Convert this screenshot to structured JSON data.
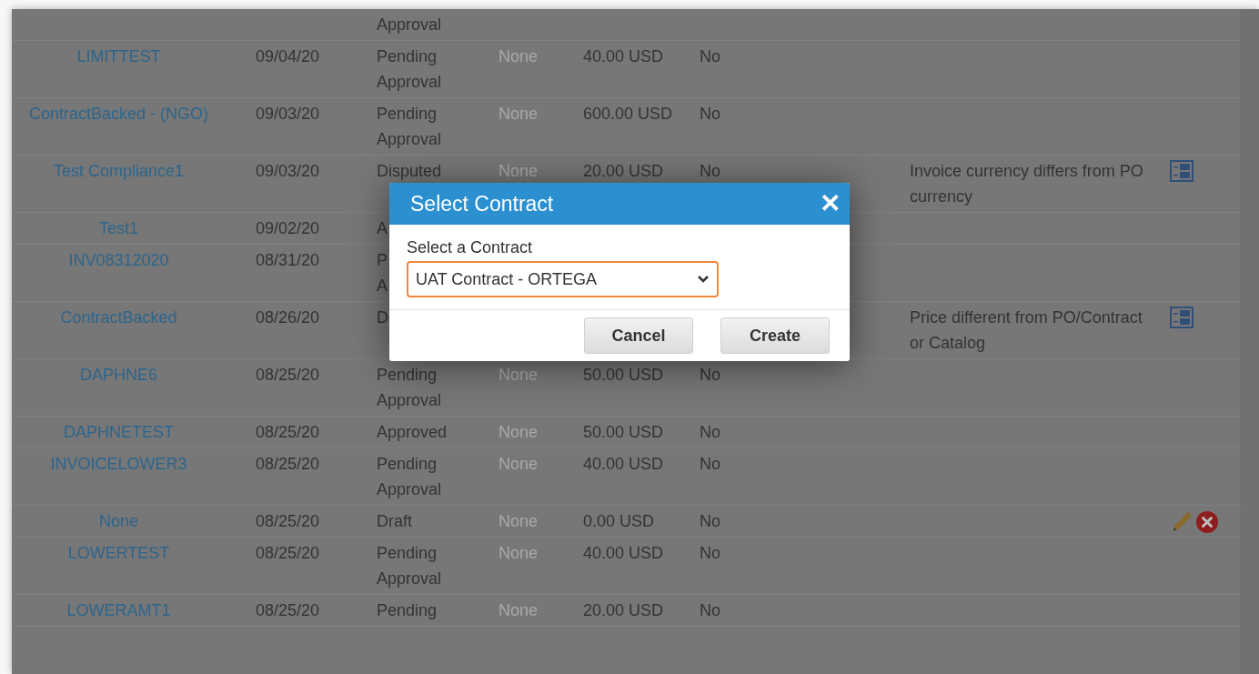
{
  "rows": [
    {
      "kind": "standard",
      "status": [
        "Approval"
      ]
    },
    {
      "kind": "standard",
      "name": "LIMITTEST",
      "date": "09/04/20",
      "status": [
        "Pending",
        "Approval"
      ],
      "column_4": "None",
      "amount": "40.00 USD",
      "column_6": "No"
    },
    {
      "kind": "standard",
      "name": "ContractBacked - (NGO)",
      "date": "09/03/20",
      "status": [
        "Pending",
        "Approval"
      ],
      "column_4": "None",
      "amount": "600.00 USD",
      "column_6": "No"
    },
    {
      "kind": "exception",
      "name": "Test Compliance1",
      "date": "09/03/20",
      "status": [
        "Disputed"
      ],
      "column_4": "None",
      "amount": "20.00 USD",
      "column_6": "No",
      "note": [
        "Invoice currency differs from PO",
        "currency"
      ]
    },
    {
      "kind": "standard",
      "name": "Test1",
      "date": "09/02/20",
      "status": [
        "A"
      ]
    },
    {
      "kind": "standard",
      "name": "INV08312020",
      "date": "08/31/20",
      "status": [
        "P",
        "A"
      ]
    },
    {
      "kind": "exception",
      "name": "ContractBacked",
      "date": "08/26/20",
      "status": [
        "D"
      ],
      "note": [
        "Price different from PO/Contract",
        "or Catalog"
      ]
    },
    {
      "kind": "standard",
      "name": "DAPHNE6",
      "date": "08/25/20",
      "status": [
        "Pending",
        "Approval"
      ],
      "column_4": "None",
      "amount": "50.00 USD",
      "column_6": "No"
    },
    {
      "kind": "standard",
      "name": "DAPHNETEST",
      "date": "08/25/20",
      "status": [
        "Approved"
      ],
      "column_4": "None",
      "amount": "50.00 USD",
      "column_6": "No"
    },
    {
      "kind": "standard",
      "name": "INVOICELOWER3",
      "date": "08/25/20",
      "status": [
        "Pending",
        "Approval"
      ],
      "column_4": "None",
      "amount": "40.00 USD",
      "column_6": "No"
    },
    {
      "kind": "draft",
      "name": "None",
      "date": "08/25/20",
      "status": [
        "Draft"
      ],
      "column_4": "None",
      "amount": "0.00 USD",
      "column_6": "No"
    },
    {
      "kind": "standard",
      "name": "LOWERTEST",
      "date": "08/25/20",
      "status": [
        "Pending",
        "Approval"
      ],
      "column_4": "None",
      "amount": "40.00 USD",
      "column_6": "No"
    },
    {
      "kind": "standard",
      "name": "LOWERAMT1",
      "date": "08/25/20",
      "status": [
        "Pending"
      ],
      "column_4": "None",
      "amount": "20.00 USD",
      "column_6": "No"
    }
  ],
  "dialog": {
    "title": "Select Contract",
    "close": "✕",
    "field_label": "Select a Contract",
    "field_value": "UAT Contract - ORTEGA",
    "buttons": [
      "Cancel",
      "Create"
    ]
  }
}
